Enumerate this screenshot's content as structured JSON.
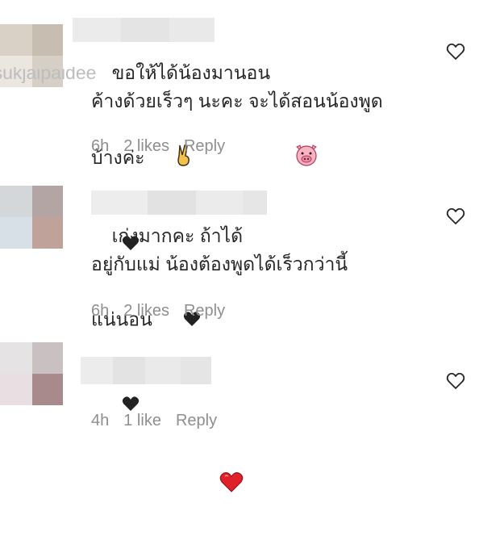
{
  "comments": [
    {
      "username_visible": "sukjaipaidee",
      "text": "ขอให้ได้น้องมานอน\nค้างด้วยเร็วๆ นะคะ จะได้สอนน้องพูด\nบ้างค่ะ",
      "emojis": [
        "victory-hand",
        "pig-face",
        "black-heart"
      ],
      "time": "6h",
      "likes": "2 likes",
      "reply": "Reply"
    },
    {
      "username_visible": "",
      "text": "เก่งมากคะ ถ้าได้\nอยู่กับแม่ น้องต้องพูดได้เร็วกว่านี้\nแน่นอน",
      "emojis": [
        "black-heart",
        "black-heart"
      ],
      "time": "6h",
      "likes": "2 likes",
      "reply": "Reply"
    },
    {
      "username_visible": "",
      "text": "",
      "emojis": [
        "red-heart"
      ],
      "time": "4h",
      "likes": "1 like",
      "reply": "Reply"
    }
  ],
  "colors": {
    "text": "#262626",
    "meta": "#8e8e8e",
    "red_heart": "#e0202a"
  }
}
